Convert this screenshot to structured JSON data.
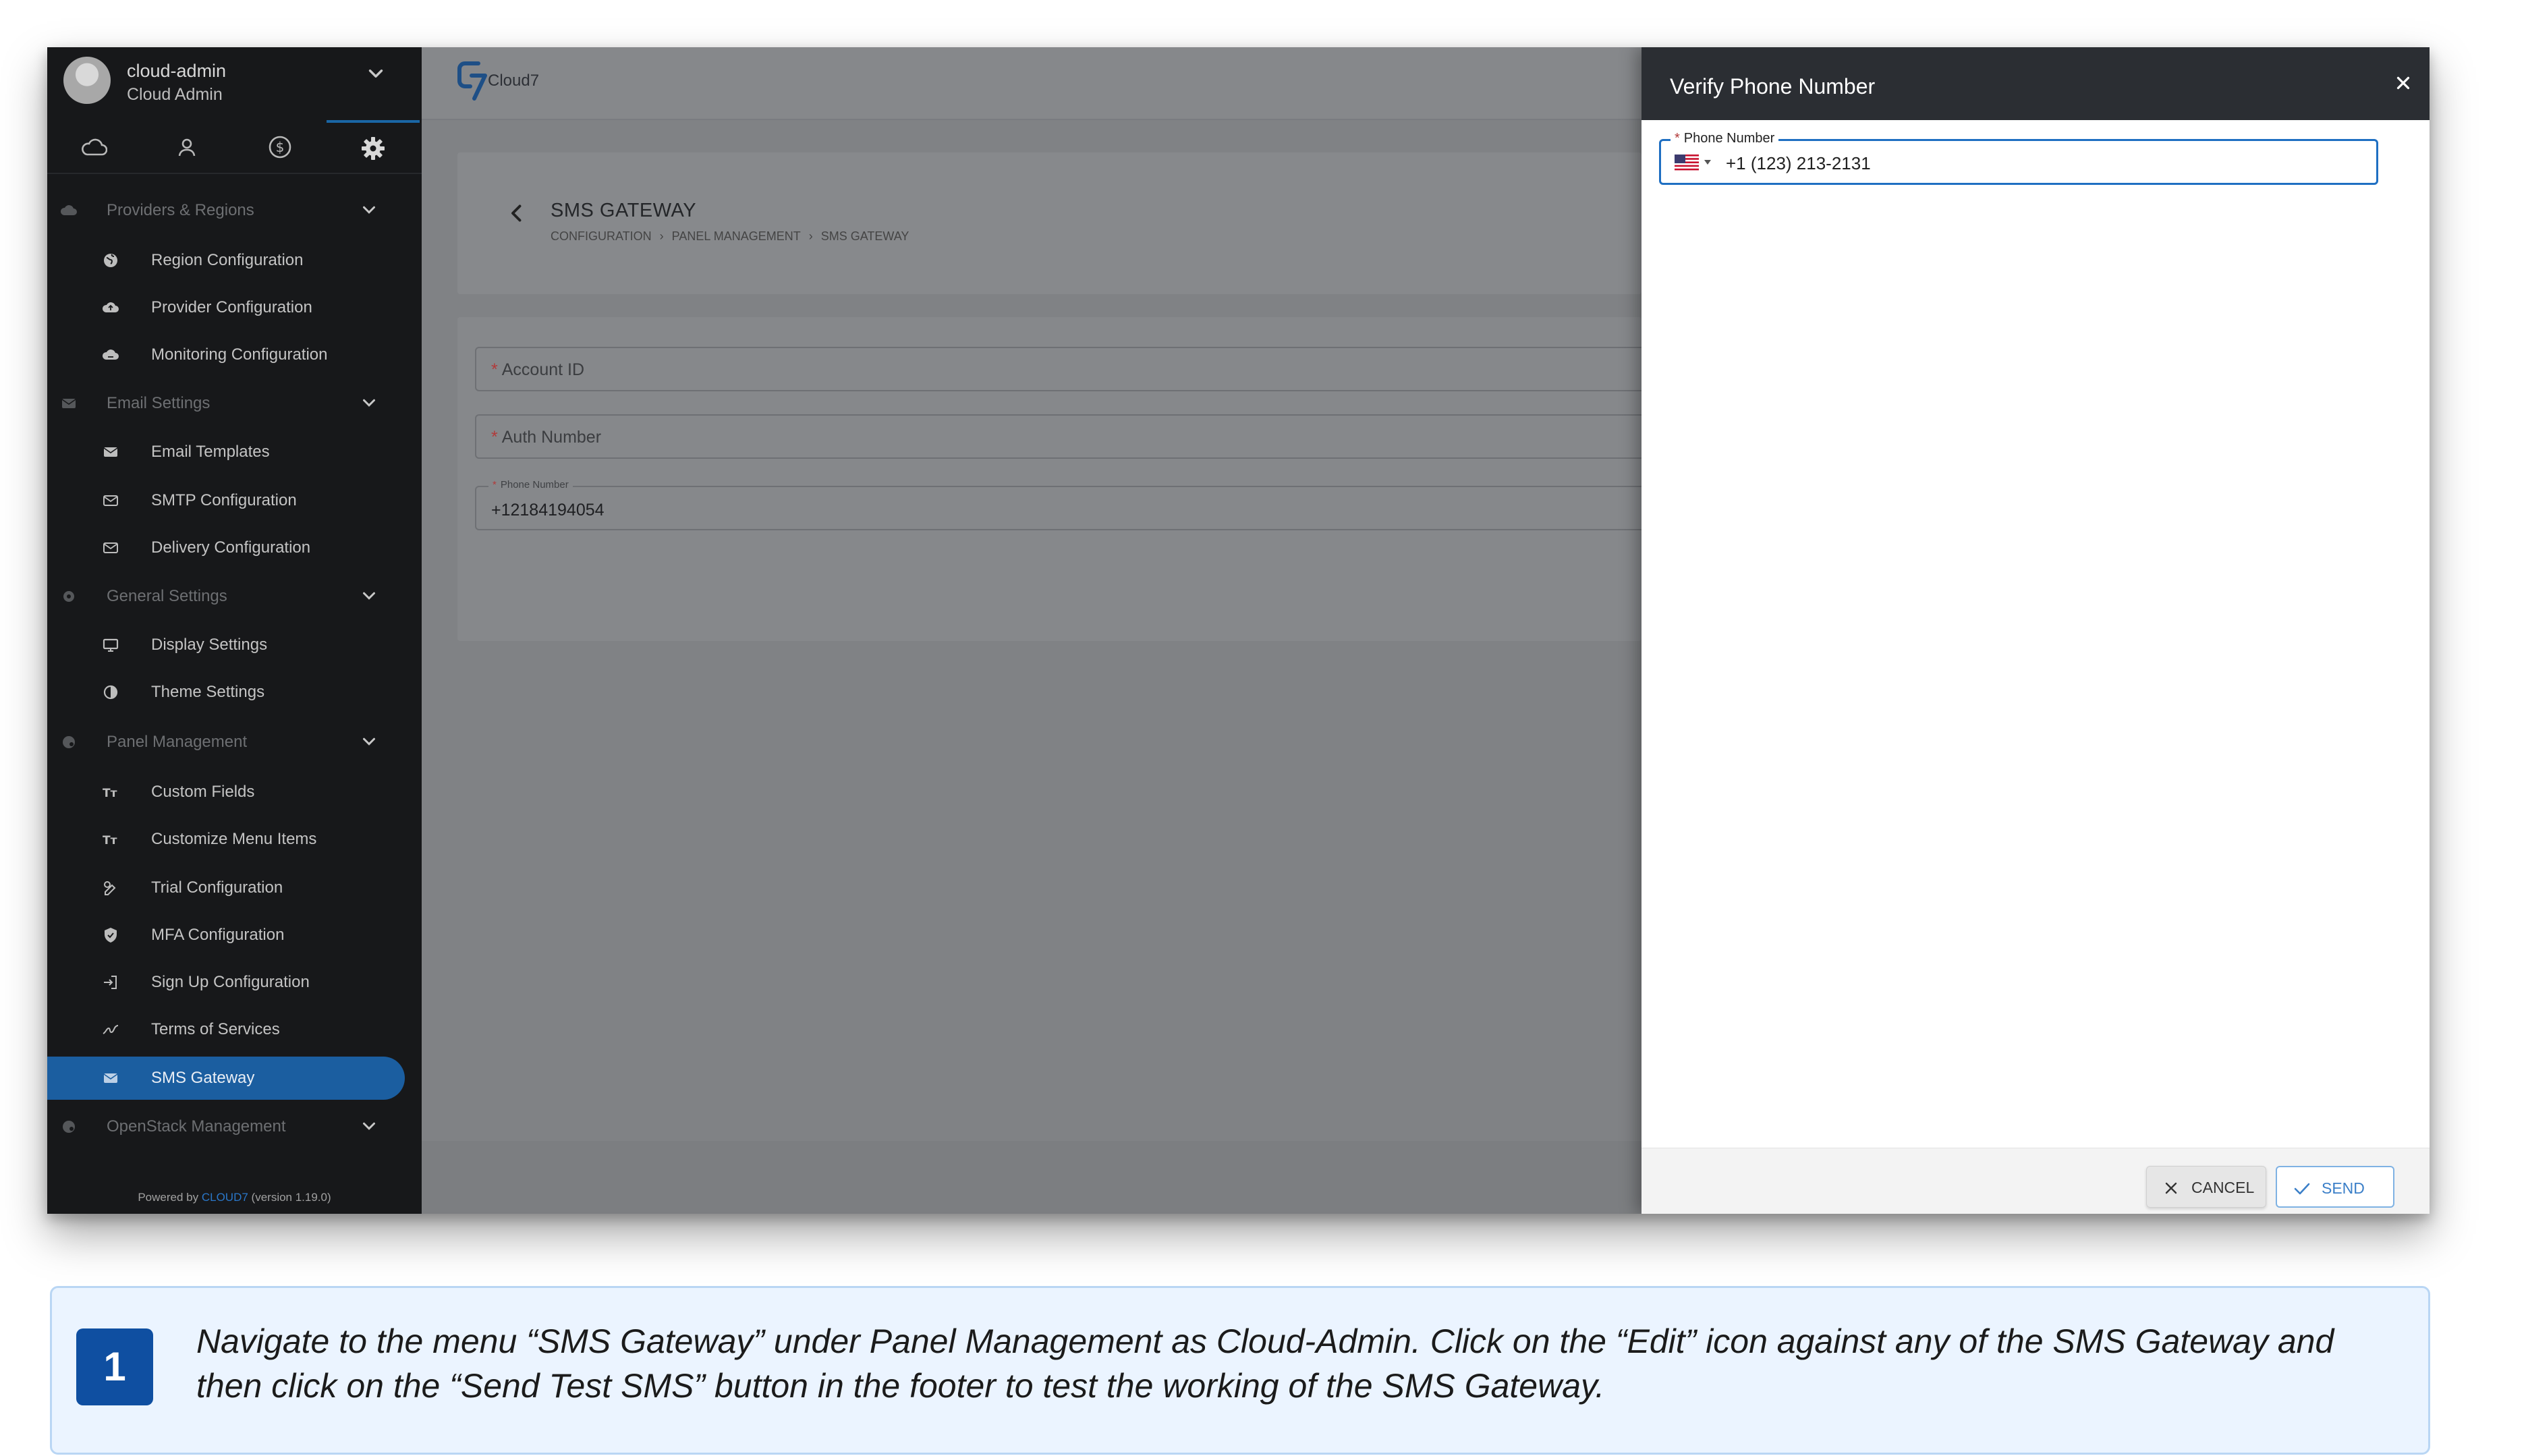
{
  "user": {
    "name": "cloud-admin",
    "role": "Cloud Admin"
  },
  "sidebar": {
    "tabs": [
      "cloud-icon",
      "user-icon",
      "dollar-icon",
      "gear-icon"
    ],
    "items": [
      {
        "type": "section",
        "label": "Providers & Regions",
        "icon": "cloud-icon"
      },
      {
        "type": "item",
        "label": "Region Configuration",
        "icon": "globe-icon"
      },
      {
        "type": "item",
        "label": "Provider Configuration",
        "icon": "cloud-upload-icon"
      },
      {
        "type": "item",
        "label": "Monitoring Configuration",
        "icon": "cloud-monitor-icon"
      },
      {
        "type": "section",
        "label": "Email Settings",
        "icon": "mail-icon"
      },
      {
        "type": "item",
        "label": "Email Templates",
        "icon": "mail-icon"
      },
      {
        "type": "item",
        "label": "SMTP Configuration",
        "icon": "mail-config-icon"
      },
      {
        "type": "item",
        "label": "Delivery Configuration",
        "icon": "mail-config-icon"
      },
      {
        "type": "section",
        "label": "General Settings",
        "icon": "gear-icon"
      },
      {
        "type": "item",
        "label": "Display Settings",
        "icon": "monitor-icon"
      },
      {
        "type": "item",
        "label": "Theme Settings",
        "icon": "contrast-icon"
      },
      {
        "type": "section",
        "label": "Panel Management",
        "icon": "palette-icon"
      },
      {
        "type": "item",
        "label": "Custom Fields",
        "icon": "text-size-icon"
      },
      {
        "type": "item",
        "label": "Customize Menu Items",
        "icon": "text-size-icon"
      },
      {
        "type": "item",
        "label": "Trial Configuration",
        "icon": "trial-icon"
      },
      {
        "type": "item",
        "label": "MFA Configuration",
        "icon": "shield-icon"
      },
      {
        "type": "item",
        "label": "Sign Up Configuration",
        "icon": "login-icon"
      },
      {
        "type": "item",
        "label": "Terms of Services",
        "icon": "signature-icon"
      },
      {
        "type": "item",
        "label": "SMS Gateway",
        "icon": "mail-icon",
        "active": true
      },
      {
        "type": "section",
        "label": "OpenStack Management",
        "icon": "palette-icon"
      }
    ],
    "powered_prefix": "Powered by ",
    "powered_brand": "CLOUD7",
    "powered_version": " (version 1.19.0)"
  },
  "topbar": {
    "logo_text": "Cloud7"
  },
  "page": {
    "title": "SMS GATEWAY",
    "breadcrumb": [
      "CONFIGURATION",
      "PANEL MANAGEMENT",
      "SMS GATEWAY"
    ],
    "breadcrumb_sep": "›",
    "fields": {
      "account_id_placeholder": "Account ID",
      "auth_number_placeholder": "Auth Number",
      "phone_label": "Phone Number",
      "phone_value": "+12184194054"
    }
  },
  "modal": {
    "title": "Verify Phone Number",
    "close": "×",
    "phone_label": "Phone Number",
    "phone_value": "+1 (123) 213-2131",
    "cancel_label": "CANCEL",
    "send_label": "SEND"
  },
  "caption": {
    "step": "1",
    "text": "Navigate to the menu “SMS Gateway” under Panel Management as Cloud-Admin. Click on the “Edit” icon against any of the SMS Gateway and then click on the “Send Test SMS” button in the footer to test the working of the SMS Gateway."
  },
  "colors": {
    "sidebar_bg": "#17181a",
    "active_item": "#1b5ea0",
    "accent_blue": "#1f6fc2",
    "modal_header": "#2b2e33",
    "required": "#b23a3a",
    "caption_bg": "#ebf4ff",
    "step_badge": "#0f4fa1"
  }
}
